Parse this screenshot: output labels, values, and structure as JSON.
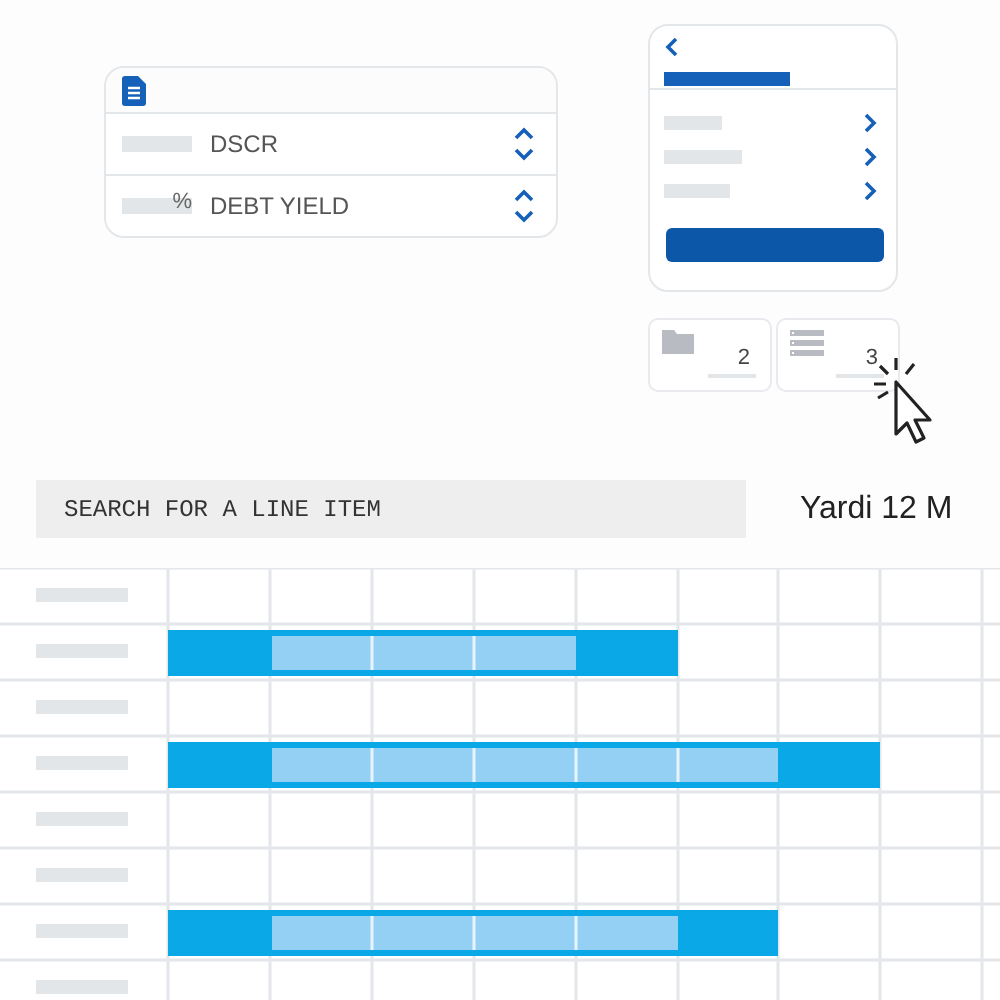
{
  "metric_card": {
    "fields": [
      {
        "label": "DSCR"
      },
      {
        "label": "DEBT YIELD",
        "suffix": "%"
      }
    ]
  },
  "tiles": [
    {
      "kind": "folder",
      "count": "2"
    },
    {
      "kind": "list",
      "count": "3"
    }
  ],
  "search": {
    "placeholder": "SEARCH FOR A LINE ITEM"
  },
  "source_label": "Yardi 12 M"
}
